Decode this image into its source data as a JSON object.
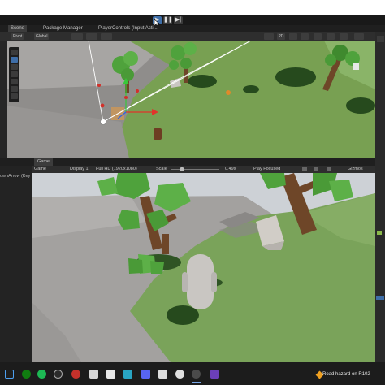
{
  "playmode": {
    "buttons": [
      {
        "name": "play-button",
        "glyph": "▶"
      },
      {
        "name": "pause-button",
        "glyph": "❚❚"
      },
      {
        "name": "step-button",
        "glyph": "▶|"
      }
    ]
  },
  "tabs": [
    {
      "label": "Scene"
    },
    {
      "label": "Package Manager"
    },
    {
      "label": "PlayerControls (Input Acti..."
    }
  ],
  "scene_toolbar": {
    "pivot": "Pivot",
    "global": "Global",
    "view_2d": "2D"
  },
  "game_view": {
    "tab_label": "Game",
    "mode_label": "Game",
    "display": "Display 1",
    "resolution": "Full HD (1920x1080)",
    "scale_label": "Scale",
    "scale_value": "0.49x",
    "focus_label": "Play Focused",
    "gizmos_label": "Gizmos"
  },
  "hierarchy": {
    "partial_text": "ownArrow (Key"
  },
  "taskbar": {
    "notification": "Road hazard on R102"
  },
  "colors": {
    "editor_bg": "#282828",
    "accent": "#3e6ea8",
    "grass": "#7aa35a",
    "ground": "#9e9c9a",
    "sky": "#c7ccd1"
  }
}
